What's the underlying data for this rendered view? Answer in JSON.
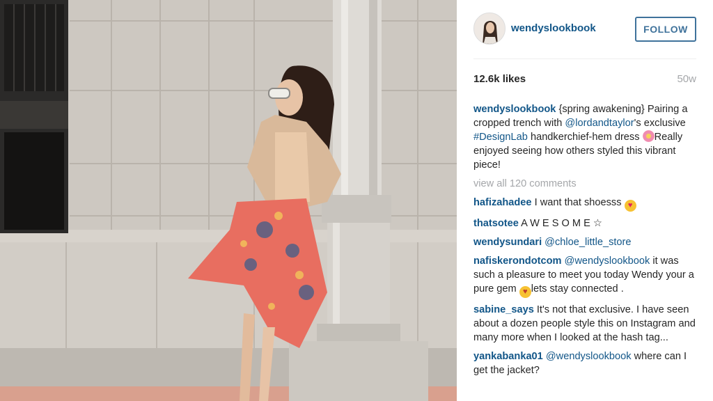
{
  "header": {
    "username": "wendyslookbook",
    "follow_label": "FOLLOW"
  },
  "stats": {
    "likes": "12.6k likes",
    "age": "50w"
  },
  "caption": {
    "username": "wendyslookbook",
    "text_1": "{spring awakening} Pairing a cropped trench with ",
    "mention": "@lordandtaylor",
    "text_2": "'s exclusive ",
    "hashtag": "#DesignLab",
    "text_3": " handkerchief-hem dress ",
    "text_4": "Really enjoyed seeing how others styled this vibrant piece!",
    "emoji": "flower-icon"
  },
  "view_all": "view all 120 comments",
  "comments": [
    {
      "user": "hafizahadee",
      "text": " I want that shoesss",
      "emoji": "heart-eyes-icon"
    },
    {
      "user": "thatsotee",
      "text": " A W E S O M E ☆"
    },
    {
      "user": "wendysundari",
      "mention": " @chloe_little_store"
    },
    {
      "user": "nafiskerondotcom",
      "mention": " @wendyslookbook",
      "text": " it was such a pleasure to meet you today Wendy your a pure gem ",
      "text_2": "lets stay connected .",
      "emoji": "kiss-icon"
    },
    {
      "user": "sabine_says",
      "text": " It's not that exclusive. I have seen about a dozen people style this on Instagram and many more when I looked at the hash tag..."
    },
    {
      "user": "yankabanka01",
      "mention": " @wendyslookbook",
      "text": " where can I get the jacket?"
    }
  ],
  "colors": {
    "link": "#125688",
    "follow": "#3f729b",
    "muted": "#a5a7aa"
  }
}
